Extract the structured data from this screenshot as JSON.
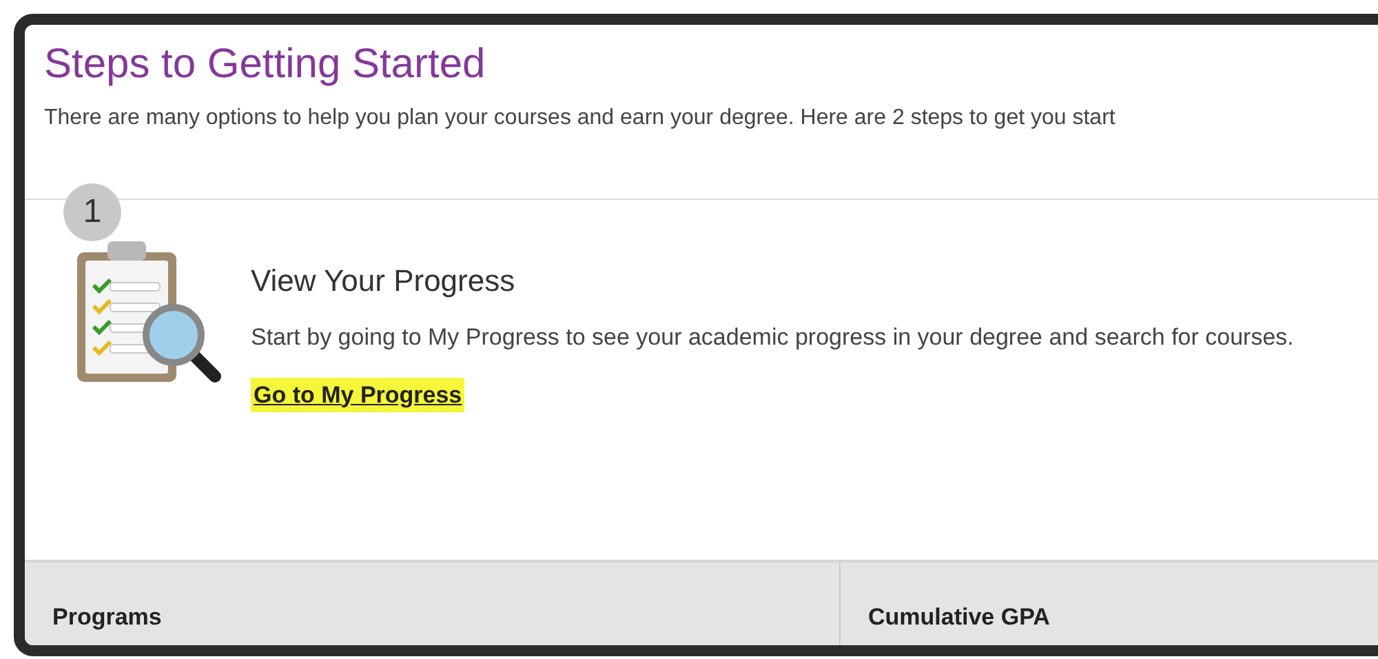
{
  "header": {
    "title": "Steps to Getting Started",
    "intro": "There are many options to help you plan your courses and earn your degree. Here are 2 steps to get you start"
  },
  "steps": [
    {
      "number": "1",
      "title": "View Your Progress",
      "description": "Start by going to My Progress to see your academic progress in your degree and search for courses.",
      "link": {
        "label": "Go to My Progress",
        "highlighted": true
      }
    }
  ],
  "summary": {
    "columns": [
      "Programs",
      "Cumulative GPA"
    ]
  }
}
